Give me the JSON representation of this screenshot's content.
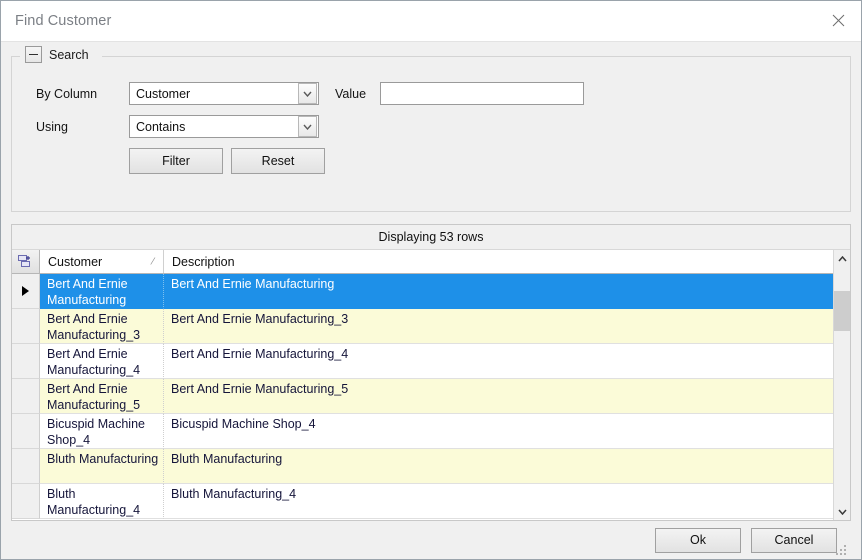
{
  "window": {
    "title": "Find Customer",
    "close_icon": "close-icon"
  },
  "search_group": {
    "title": "Search",
    "collapse_icon": "minus-icon",
    "by_column_label": "By Column",
    "by_column_value": "Customer",
    "using_label": "Using",
    "using_value": "Contains",
    "value_label": "Value",
    "value_text": "",
    "value_placeholder": "",
    "filter_button": "Filter",
    "reset_button": "Reset",
    "dropdown_icon": "chevron-down-icon"
  },
  "grid": {
    "status_text": "Displaying 53 rows",
    "corner_icon": "column-chooser-icon",
    "row_indicator_icon": "triangle-right-icon",
    "sort_indicator": "⁄",
    "columns": [
      {
        "key": "customer",
        "label": "Customer",
        "sorted": true
      },
      {
        "key": "description",
        "label": "Description",
        "sorted": false
      }
    ],
    "rows": [
      {
        "customer": "Bert And Ernie Manufacturing",
        "description": "Bert And Ernie Manufacturing",
        "state": "selected"
      },
      {
        "customer": "Bert And Ernie Manufacturing_3",
        "description": "Bert And Ernie Manufacturing_3",
        "state": "alt"
      },
      {
        "customer": "Bert And Ernie Manufacturing_4",
        "description": "Bert And Ernie Manufacturing_4",
        "state": "plain"
      },
      {
        "customer": "Bert And Ernie Manufacturing_5",
        "description": "Bert And Ernie Manufacturing_5",
        "state": "alt"
      },
      {
        "customer": "Bicuspid Machine Shop_4",
        "description": "Bicuspid Machine Shop_4",
        "state": "plain"
      },
      {
        "customer": "Bluth Manufacturing",
        "description": "Bluth Manufacturing",
        "state": "alt"
      },
      {
        "customer": "Bluth Manufacturing_4",
        "description": "Bluth Manufacturing_4",
        "state": "plain"
      }
    ],
    "scrollbar": {
      "up_icon": "chevron-up-icon",
      "down_icon": "chevron-down-icon"
    }
  },
  "footer": {
    "ok_button": "Ok",
    "cancel_button": "Cancel",
    "grip_icon": "resize-grip-icon"
  },
  "colors": {
    "selection": "#1e90e8",
    "alt_row": "#fbfbd8",
    "dialog_bg": "#f0f0f0"
  }
}
